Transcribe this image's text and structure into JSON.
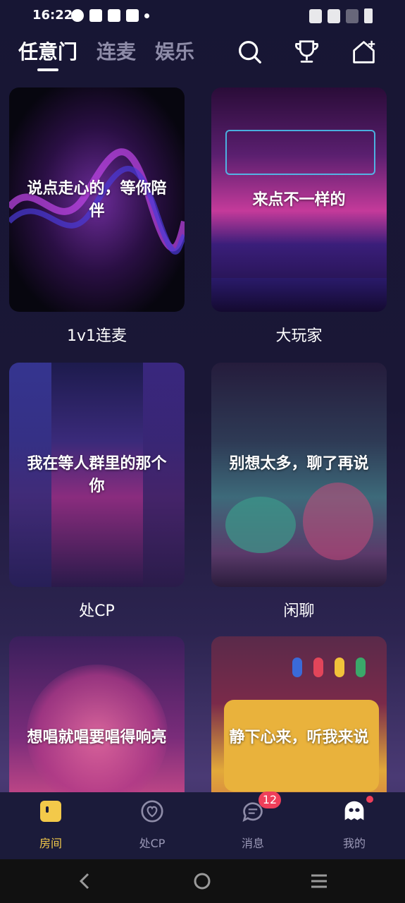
{
  "status_bar": {
    "time": "16:22"
  },
  "top_tabs": [
    {
      "label": "任意门",
      "active": true
    },
    {
      "label": "连麦",
      "active": false
    },
    {
      "label": "娱乐",
      "active": false
    }
  ],
  "top_actions": [
    "search-icon",
    "trophy-icon",
    "home-plus-icon"
  ],
  "cards": [
    {
      "text": "说点走心的，等你陪伴",
      "caption": "1v1连麦"
    },
    {
      "text": "来点不一样的",
      "caption": "大玩家"
    },
    {
      "text": "我在等人群里的那个你",
      "caption": "处CP"
    },
    {
      "text": "别想太多，聊了再说",
      "caption": "闲聊"
    },
    {
      "text": "想唱就唱要唱得响亮",
      "caption": ""
    },
    {
      "text": "静下心来，听我来说",
      "caption": ""
    }
  ],
  "bottom_nav": [
    {
      "label": "房间",
      "active": true,
      "icon": "room-icon"
    },
    {
      "label": "处CP",
      "active": false,
      "icon": "heart-icon"
    },
    {
      "label": "消息",
      "active": false,
      "icon": "message-icon",
      "badge": "12"
    },
    {
      "label": "我的",
      "active": false,
      "icon": "profile-ghost-icon"
    }
  ],
  "colors": {
    "accent": "#f3c94a",
    "badge": "#ef3f5a",
    "nav_bg": "#1b1b3a"
  }
}
